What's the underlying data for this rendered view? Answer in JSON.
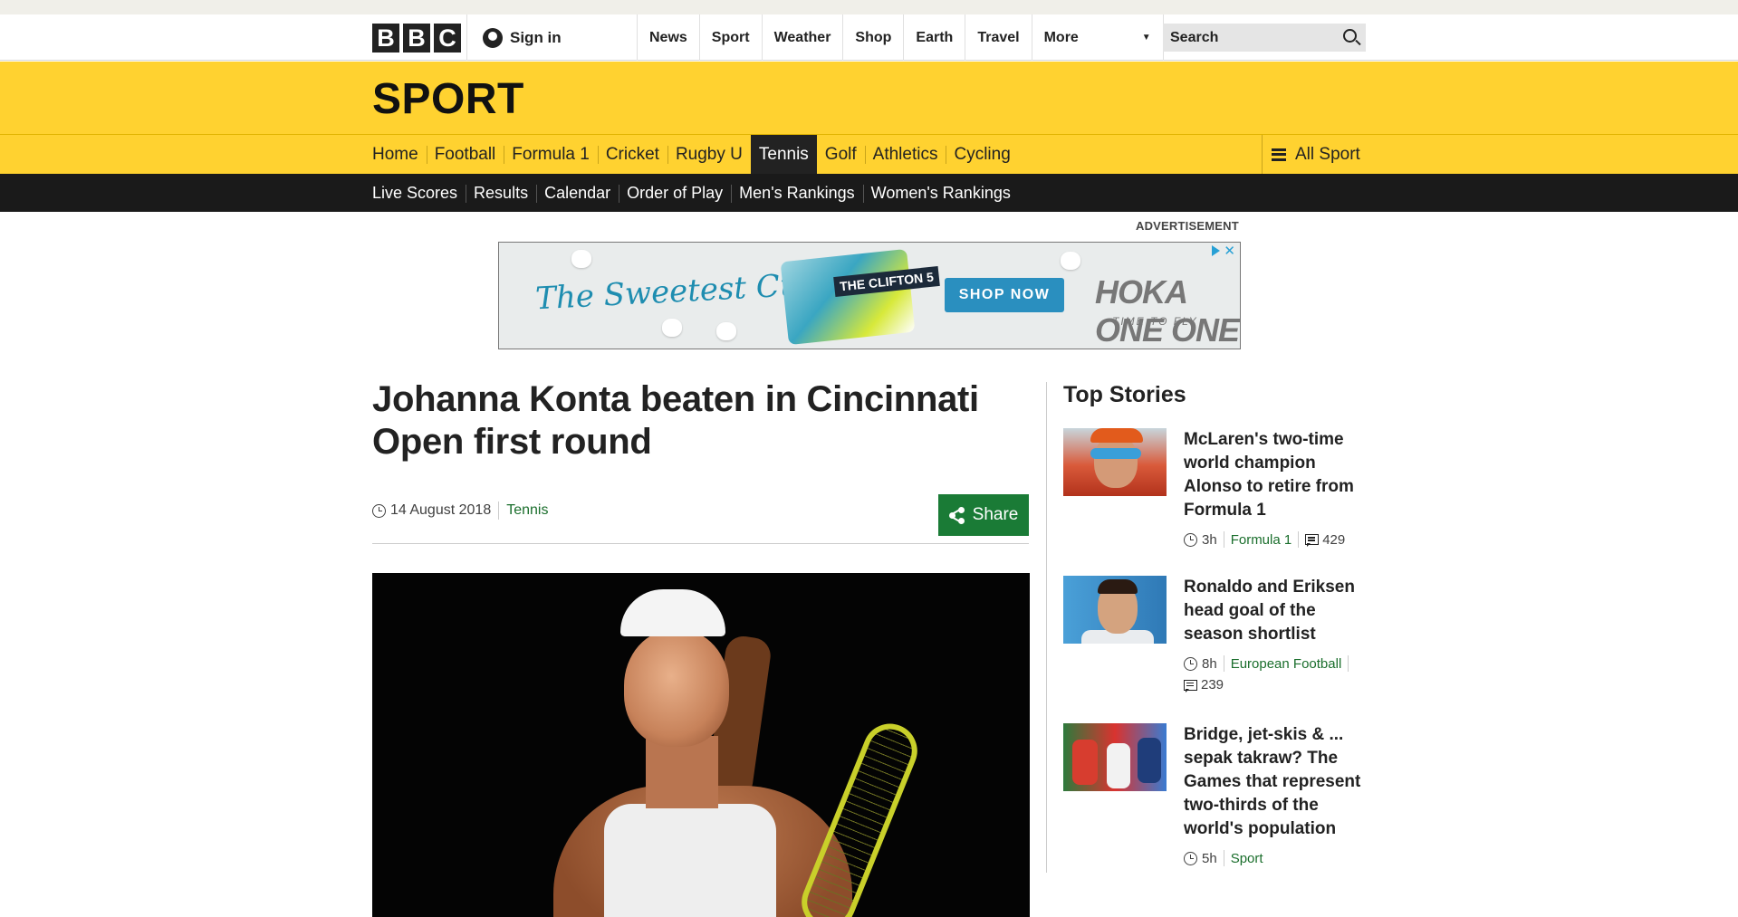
{
  "global_header": {
    "logo_letters": [
      "B",
      "B",
      "C"
    ],
    "sign_in_label": "Sign in",
    "nav_items": [
      "News",
      "Sport",
      "Weather",
      "Shop",
      "Earth",
      "Travel"
    ],
    "more_label": "More",
    "search_placeholder": "Search"
  },
  "sport_header": {
    "title": "SPORT",
    "nav_items": [
      "Home",
      "Football",
      "Formula 1",
      "Cricket",
      "Rugby U",
      "Tennis",
      "Golf",
      "Athletics",
      "Cycling"
    ],
    "active_item": "Tennis",
    "all_sport_label": "All Sport"
  },
  "sub_nav": {
    "items": [
      "Live Scores",
      "Results",
      "Calendar",
      "Order of Play",
      "Men's Rankings",
      "Women's Rankings"
    ]
  },
  "advertisement": {
    "label": "ADVERTISEMENT",
    "tagline": "The Sweetest Cushion!",
    "product": "THE CLIFTON 5",
    "cta": "SHOP NOW",
    "brand": "HOKA ONE ONE",
    "brand_slogan": "TIME TO FLY"
  },
  "article": {
    "headline": "Johanna Konta beaten in Cincinnati Open first round",
    "date": "14 August 2018",
    "topic": "Tennis",
    "share_label": "Share"
  },
  "sidebar": {
    "title": "Top Stories",
    "stories": [
      {
        "title": "McLaren's two-time world champion Alonso to retire from Formula 1",
        "age": "3h",
        "topic": "Formula 1",
        "comments": "429"
      },
      {
        "title": "Ronaldo and Eriksen head goal of the season shortlist",
        "age": "8h",
        "topic": "European Football",
        "comments": "239"
      },
      {
        "title": "Bridge, jet-skis & ... sepak takraw? The Games that represent two-thirds of the world's population",
        "age": "5h",
        "topic": "Sport"
      }
    ]
  },
  "colors": {
    "sport_yellow": "#ffd230",
    "subnav_black": "#1a1a1a",
    "link_green": "#1a6e2c",
    "share_green": "#1a7b36"
  }
}
